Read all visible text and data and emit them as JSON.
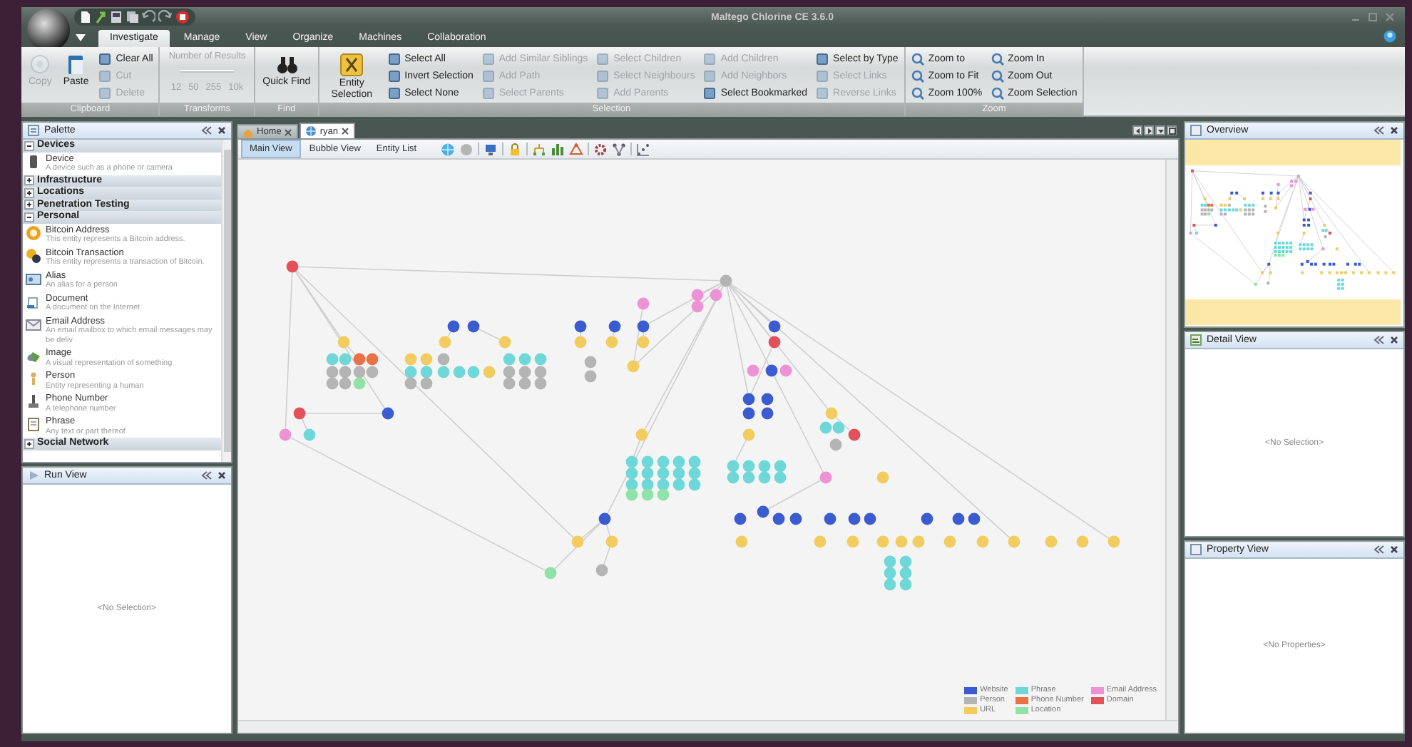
{
  "window": {
    "title": "Maltego Chlorine CE 3.6.0"
  },
  "ribbon_tabs": [
    {
      "label": "Investigate",
      "selected": true
    },
    {
      "label": "Manage",
      "selected": false
    },
    {
      "label": "View",
      "selected": false
    },
    {
      "label": "Organize",
      "selected": false
    },
    {
      "label": "Machines",
      "selected": false
    },
    {
      "label": "Collaboration",
      "selected": false
    }
  ],
  "ribbon_groups": [
    {
      "label": "Clipboard",
      "columns": [
        {
          "kind": "large",
          "items": [
            {
              "label": "Copy",
              "disabled": true
            }
          ]
        },
        {
          "kind": "large",
          "items": [
            {
              "label": "Paste",
              "disabled": false
            }
          ]
        },
        {
          "kind": "stack",
          "items": [
            {
              "label": "Clear All",
              "disabled": false
            },
            {
              "label": "Cut",
              "disabled": true
            },
            {
              "label": "Delete",
              "disabled": true
            }
          ]
        }
      ]
    },
    {
      "label": "Transforms",
      "columns": [
        {
          "kind": "results",
          "caption": "Number of Results",
          "ticks": [
            "12",
            "50",
            "255",
            "10k"
          ],
          "disabled": true
        }
      ]
    },
    {
      "label": "Find",
      "columns": [
        {
          "kind": "large",
          "items": [
            {
              "label": "Quick Find",
              "disabled": false
            }
          ]
        }
      ]
    },
    {
      "label": "Selection",
      "columns": [
        {
          "kind": "large",
          "items": [
            {
              "label": "Entity Selection",
              "disabled": false
            }
          ]
        },
        {
          "kind": "stack",
          "items": [
            {
              "label": "Select All",
              "disabled": false
            },
            {
              "label": "Invert Selection",
              "disabled": false
            },
            {
              "label": "Select None",
              "disabled": false
            }
          ]
        },
        {
          "kind": "stack",
          "items": [
            {
              "label": "Add Similar Siblings",
              "disabled": true
            },
            {
              "label": "Add Path",
              "disabled": true
            },
            {
              "label": "Select Parents",
              "disabled": true
            }
          ]
        },
        {
          "kind": "stack",
          "items": [
            {
              "label": "Select Children",
              "disabled": true
            },
            {
              "label": "Select Neighbours",
              "disabled": true
            },
            {
              "label": "Add Parents",
              "disabled": true
            }
          ]
        },
        {
          "kind": "stack",
          "items": [
            {
              "label": "Add Children",
              "disabled": true
            },
            {
              "label": "Add Neighbors",
              "disabled": true
            },
            {
              "label": "Select Bookmarked",
              "disabled": false
            }
          ]
        },
        {
          "kind": "stack",
          "items": [
            {
              "label": "Select by Type",
              "disabled": false
            },
            {
              "label": "Select Links",
              "disabled": true
            },
            {
              "label": "Reverse Links",
              "disabled": true
            }
          ]
        }
      ]
    },
    {
      "label": "Zoom",
      "columns": [
        {
          "kind": "stack",
          "items": [
            {
              "label": "Zoom to",
              "disabled": false
            },
            {
              "label": "Zoom to Fit",
              "disabled": false
            },
            {
              "label": "Zoom 100%",
              "disabled": false
            }
          ]
        },
        {
          "kind": "stack",
          "items": [
            {
              "label": "Zoom In",
              "disabled": false
            },
            {
              "label": "Zoom Out",
              "disabled": false
            },
            {
              "label": "Zoom Selection",
              "disabled": false
            }
          ]
        }
      ]
    }
  ],
  "palette": {
    "title": "Palette",
    "categories": [
      {
        "name": "Devices",
        "expanded": true,
        "entities": [
          {
            "name": "Device",
            "description": "A device such as a phone or camera"
          }
        ]
      },
      {
        "name": "Infrastructure",
        "expanded": false
      },
      {
        "name": "Locations",
        "expanded": false
      },
      {
        "name": "Penetration Testing",
        "expanded": false
      },
      {
        "name": "Personal",
        "expanded": true,
        "entities": [
          {
            "name": "Bitcoin Address",
            "description": "This entity represents a Bitcoin address."
          },
          {
            "name": "Bitcoin Transaction",
            "description": "This entity represents a transaction of Bitcoin."
          },
          {
            "name": "Alias",
            "description": "An alias for a person"
          },
          {
            "name": "Document",
            "description": "A document on the Internet"
          },
          {
            "name": "Email Address",
            "description": "An email mailbox to which email messages may be deliv"
          },
          {
            "name": "Image",
            "description": "A visual representation of something"
          },
          {
            "name": "Person",
            "description": "Entity representing a human"
          },
          {
            "name": "Phone Number",
            "description": "A telephone number"
          },
          {
            "name": "Phrase",
            "description": "Any text or part thereof"
          }
        ]
      },
      {
        "name": "Social Network",
        "expanded": false
      }
    ]
  },
  "run_view": {
    "title": "Run View",
    "empty_text": "<No Selection>"
  },
  "graph": {
    "documents": [
      {
        "label": "Home",
        "selected": false
      },
      {
        "label": "ryan",
        "selected": true
      }
    ],
    "views": [
      {
        "label": "Main View",
        "selected": true
      },
      {
        "label": "Bubble View",
        "selected": false
      },
      {
        "label": "Entity List",
        "selected": false
      }
    ],
    "nodes": [
      {
        "color": "#e2505c"
      },
      {
        "color": "#b4b4b4"
      },
      {
        "color": "#ee92d6"
      },
      {
        "color": "#ee92d6"
      },
      {
        "color": "#ee92d6"
      },
      {
        "color": "#ee92d6"
      },
      {
        "color": "#3b5bd0"
      },
      {
        "color": "#3b5bd0"
      },
      {
        "color": "#3b5bd0"
      },
      {
        "color": "#3b5bd0"
      },
      {
        "color": "#3b5bd0"
      },
      {
        "color": "#3b5bd0"
      },
      {
        "color": "#f2cc5e"
      },
      {
        "color": "#f2cc5e"
      },
      {
        "color": "#f2cc5e"
      },
      {
        "color": "#f2cc5e"
      },
      {
        "color": "#f2cc5e"
      },
      {
        "color": "#f2cc5e"
      },
      {
        "color": "#e2505c"
      },
      {
        "color": "#6ed8d8"
      },
      {
        "color": "#6ed8d8"
      },
      {
        "color": "#e87246"
      },
      {
        "color": "#e87246"
      },
      {
        "color": "#b4b4b4"
      },
      {
        "color": "#b4b4b4"
      },
      {
        "color": "#b4b4b4"
      },
      {
        "color": "#b4b4b4"
      },
      {
        "color": "#b4b4b4"
      },
      {
        "color": "#b4b4b4"
      },
      {
        "color": "#90e2a6"
      },
      {
        "color": "#f2cc5e"
      },
      {
        "color": "#f2cc5e"
      },
      {
        "color": "#b4b4b4"
      },
      {
        "color": "#6ed8d8"
      },
      {
        "color": "#6ed8d8"
      },
      {
        "color": "#6ed8d8"
      },
      {
        "color": "#6ed8d8"
      },
      {
        "color": "#6ed8d8"
      },
      {
        "color": "#b4b4b4"
      },
      {
        "color": "#b4b4b4"
      },
      {
        "color": "#f2cc5e"
      },
      {
        "color": "#6ed8d8"
      },
      {
        "color": "#6ed8d8"
      },
      {
        "color": "#6ed8d8"
      },
      {
        "color": "#b4b4b4"
      },
      {
        "color": "#b4b4b4"
      },
      {
        "color": "#b4b4b4"
      },
      {
        "color": "#b4b4b4"
      },
      {
        "color": "#b4b4b4"
      },
      {
        "color": "#b4b4b4"
      },
      {
        "color": "#b4b4b4"
      },
      {
        "color": "#b4b4b4"
      },
      {
        "color": "#f2cc5e"
      },
      {
        "color": "#ee92d6"
      },
      {
        "color": "#3b5bd0"
      },
      {
        "color": "#ee92d6"
      },
      {
        "color": "#3b5bd0"
      },
      {
        "color": "#e2505c"
      },
      {
        "color": "#ee92d6"
      },
      {
        "color": "#6ed8d8"
      },
      {
        "color": "#3b5bd0"
      },
      {
        "color": "#3b5bd0"
      },
      {
        "color": "#3b5bd0"
      },
      {
        "color": "#3b5bd0"
      },
      {
        "color": "#f2cc5e"
      },
      {
        "color": "#6ed8d8"
      },
      {
        "color": "#6ed8d8"
      },
      {
        "color": "#e2505c"
      },
      {
        "color": "#f2cc5e"
      },
      {
        "color": "#f2cc5e"
      },
      {
        "color": "#b4b4b4"
      },
      {
        "color": "#6ed8d8"
      },
      {
        "color": "#6ed8d8"
      },
      {
        "color": "#6ed8d8"
      },
      {
        "color": "#6ed8d8"
      },
      {
        "color": "#6ed8d8"
      },
      {
        "color": "#6ed8d8"
      },
      {
        "color": "#6ed8d8"
      },
      {
        "color": "#6ed8d8"
      },
      {
        "color": "#6ed8d8"
      },
      {
        "color": "#6ed8d8"
      },
      {
        "color": "#6ed8d8"
      },
      {
        "color": "#6ed8d8"
      },
      {
        "color": "#6ed8d8"
      },
      {
        "color": "#6ed8d8"
      },
      {
        "color": "#6ed8d8"
      },
      {
        "color": "#90e2a6"
      },
      {
        "color": "#90e2a6"
      },
      {
        "color": "#90e2a6"
      },
      {
        "color": "#6ed8d8"
      },
      {
        "color": "#6ed8d8"
      },
      {
        "color": "#6ed8d8"
      },
      {
        "color": "#6ed8d8"
      },
      {
        "color": "#6ed8d8"
      },
      {
        "color": "#6ed8d8"
      },
      {
        "color": "#6ed8d8"
      },
      {
        "color": "#6ed8d8"
      },
      {
        "color": "#ee92d6"
      },
      {
        "color": "#f2cc5e"
      },
      {
        "color": "#3b5bd0"
      },
      {
        "color": "#3b5bd0"
      },
      {
        "color": "#3b5bd0"
      },
      {
        "color": "#3b5bd0"
      },
      {
        "color": "#3b5bd0"
      },
      {
        "color": "#3b5bd0"
      },
      {
        "color": "#3b5bd0"
      },
      {
        "color": "#3b5bd0"
      },
      {
        "color": "#3b5bd0"
      },
      {
        "color": "#3b5bd0"
      },
      {
        "color": "#3b5bd0"
      },
      {
        "color": "#f2cc5e"
      },
      {
        "color": "#f2cc5e"
      },
      {
        "color": "#f2cc5e"
      },
      {
        "color": "#f2cc5e"
      },
      {
        "color": "#f2cc5e"
      },
      {
        "color": "#f2cc5e"
      },
      {
        "color": "#f2cc5e"
      },
      {
        "color": "#f2cc5e"
      },
      {
        "color": "#f2cc5e"
      },
      {
        "color": "#f2cc5e"
      },
      {
        "color": "#f2cc5e"
      },
      {
        "color": "#f2cc5e"
      },
      {
        "color": "#f2cc5e"
      },
      {
        "color": "#f2cc5e"
      },
      {
        "color": "#b4b4b4"
      },
      {
        "color": "#90e2a6"
      },
      {
        "color": "#6ed8d8"
      },
      {
        "color": "#6ed8d8"
      },
      {
        "color": "#6ed8d8"
      },
      {
        "color": "#6ed8d8"
      },
      {
        "color": "#6ed8d8"
      },
      {
        "color": "#6ed8d8"
      }
    ],
    "legend": [
      {
        "label": "Website",
        "color": "#3b5bd0"
      },
      {
        "label": "Phrase",
        "color": "#6ed8d8"
      },
      {
        "label": "Email Address",
        "color": "#ee92d6"
      },
      {
        "label": "Person",
        "color": "#b4b4b4"
      },
      {
        "label": "Phone Number",
        "color": "#e87246"
      },
      {
        "label": "Domain",
        "color": "#e2505c"
      },
      {
        "label": "URL",
        "color": "#f2cc5e"
      },
      {
        "label": "Location",
        "color": "#90e2a6"
      }
    ]
  },
  "overview": {
    "title": "Overview"
  },
  "detail_view": {
    "title": "Detail View",
    "empty_text": "<No Selection>"
  },
  "property_view": {
    "title": "Property View",
    "empty_text": "<No Properties>"
  }
}
